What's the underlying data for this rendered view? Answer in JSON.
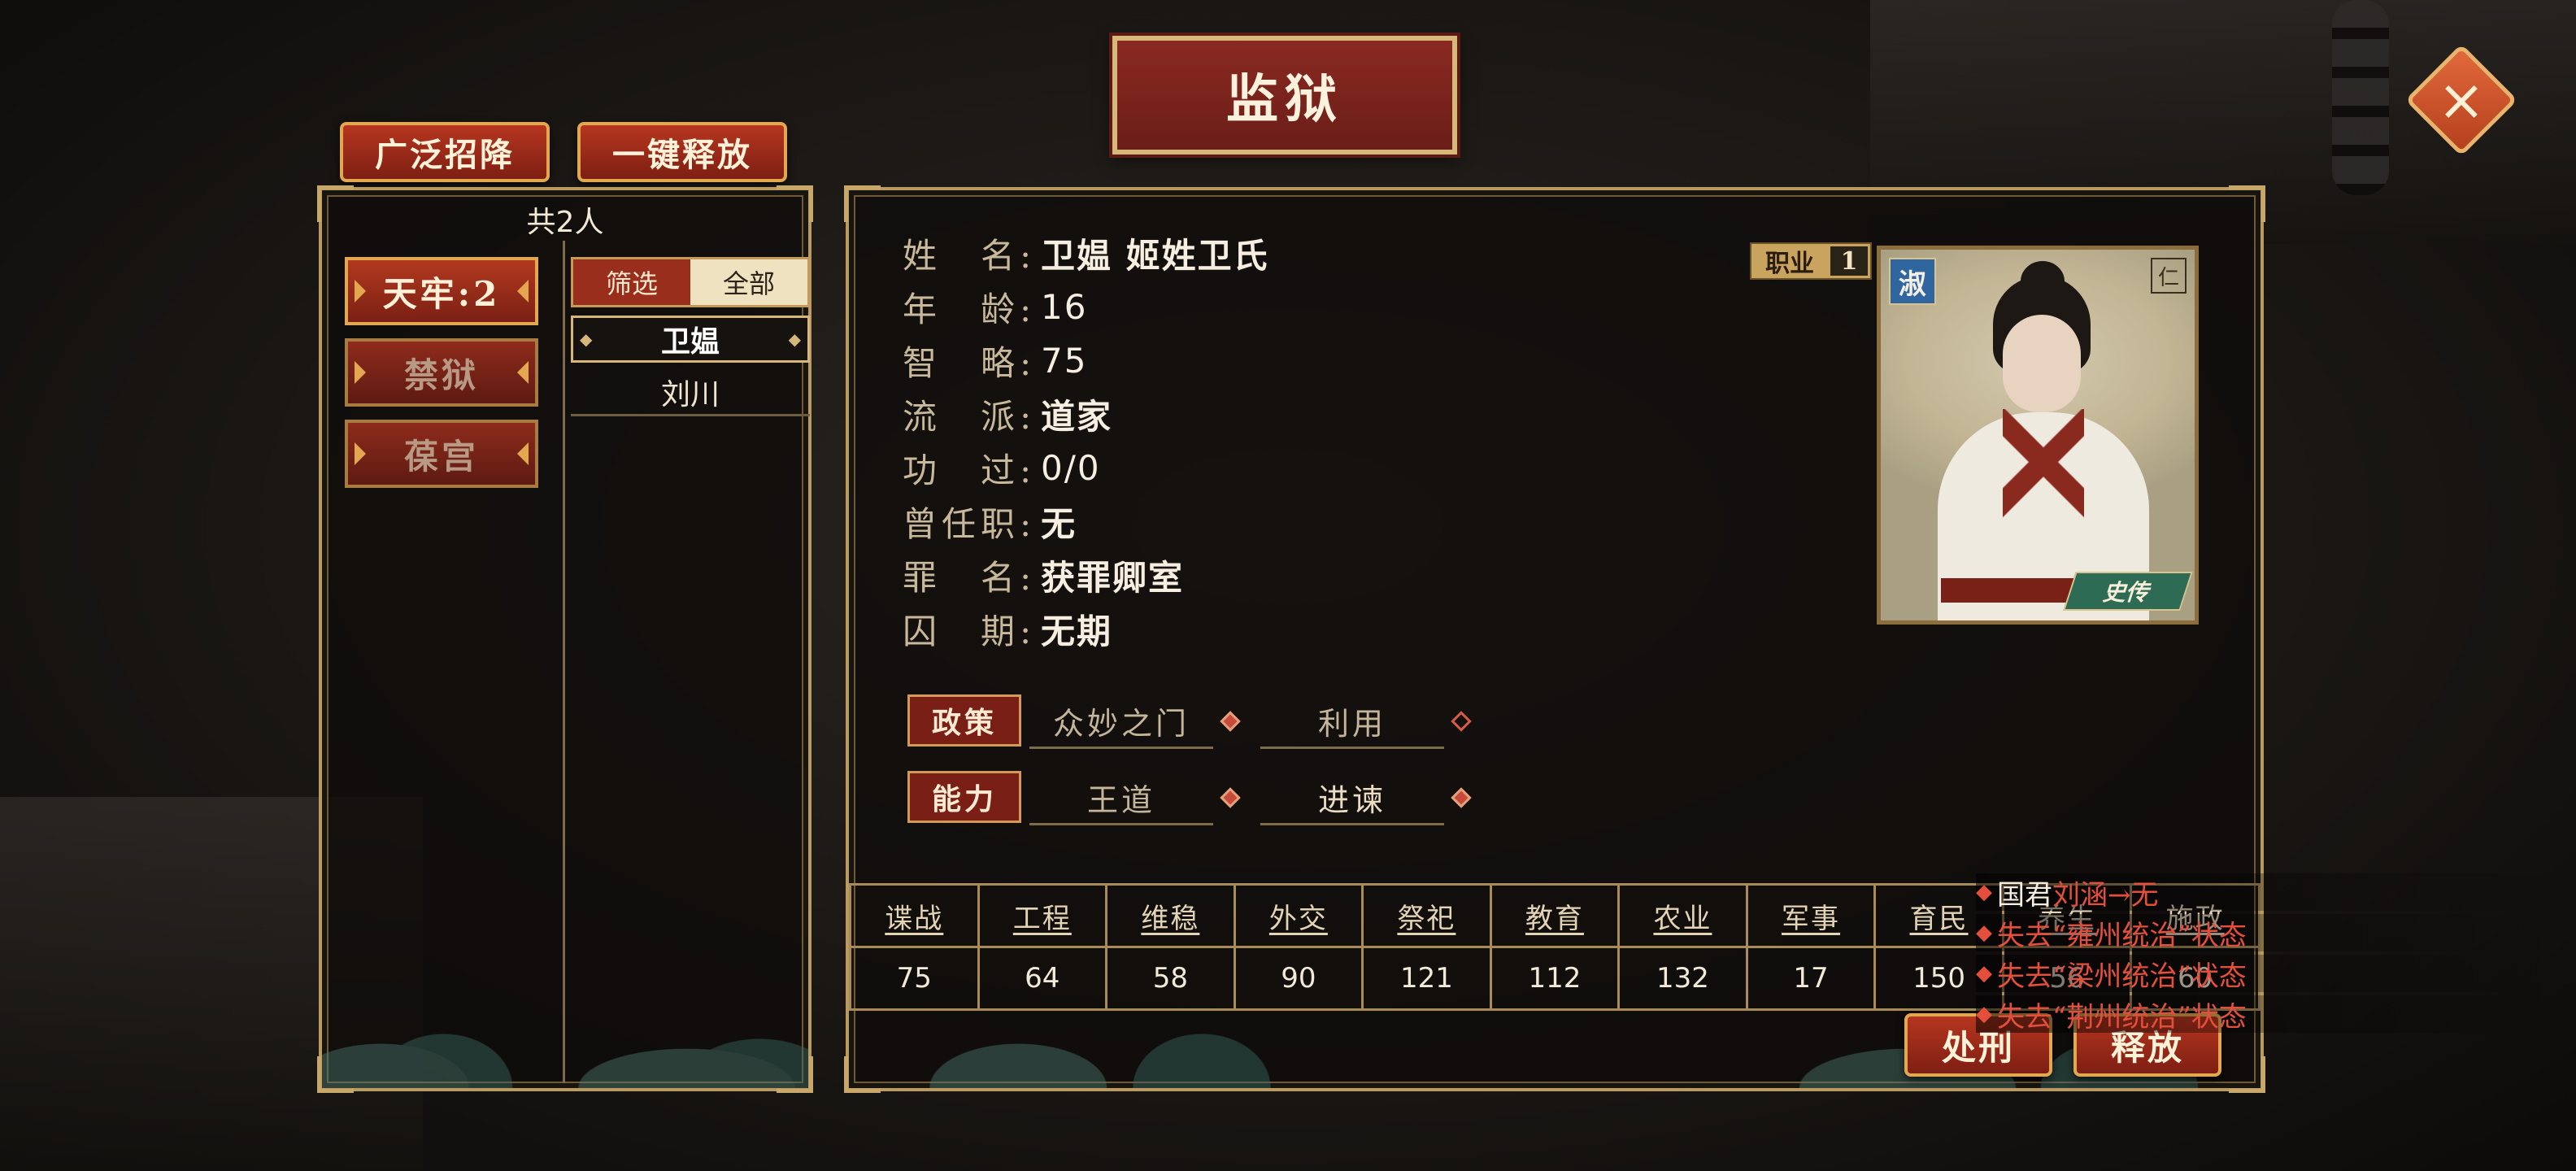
{
  "title": "监狱",
  "top_buttons": {
    "recruit_all": "广泛招降",
    "release_all": "一键释放"
  },
  "prison_panel": {
    "total": "共2人",
    "categories": [
      {
        "label": "天牢:2",
        "active": true
      },
      {
        "label": "禁狱",
        "active": false
      },
      {
        "label": "葆宫",
        "active": false
      }
    ],
    "filter": {
      "label": "筛选",
      "value": "全部"
    },
    "prisoners": [
      "卫媪",
      "刘川"
    ]
  },
  "info": {
    "labels": {
      "name": "姓　名:",
      "age": "年　龄:",
      "strategy": "智　略:",
      "school": "流　派:",
      "merit": "功　过:",
      "former_post": "曾任职:",
      "crime": "罪　名:",
      "sentence": "囚　期:"
    },
    "values": {
      "name": "卫媪  姬姓卫氏",
      "age": "16",
      "strategy": "75",
      "school": "道家",
      "merit": "0/0",
      "former_post": "无",
      "crime": "获罪卿室",
      "sentence": "无期"
    },
    "job_label": "职业",
    "job_level": "1"
  },
  "portrait": {
    "trait_badge": "淑",
    "corner_badge": "仁",
    "bio_label": "史传"
  },
  "policy": {
    "label": "政策",
    "items": [
      "众妙之门",
      "利用"
    ]
  },
  "ability": {
    "label": "能力",
    "items": [
      "王道",
      "进谏"
    ]
  },
  "stats": {
    "headers": [
      "谍战",
      "工程",
      "维稳",
      "外交",
      "祭祀",
      "教育",
      "农业",
      "军事",
      "育民",
      "养生",
      "施政"
    ],
    "values": [
      "75",
      "64",
      "58",
      "90",
      "121",
      "112",
      "132",
      "17",
      "150",
      "56",
      "60"
    ]
  },
  "actions": {
    "execute": "处刑",
    "release": "释放"
  },
  "notifications": [
    {
      "prefix": "国君",
      "text": "刘涵→无"
    },
    {
      "prefix": "",
      "text": "失去“雍州统治”状态"
    },
    {
      "prefix": "",
      "text": "失去“梁州统治”状态"
    },
    {
      "prefix": "",
      "text": "失去“荆州统治”状态"
    }
  ],
  "colors": {
    "accent_red": "#8a2a22",
    "gold": "#d8b77a",
    "alert_red": "#e44f3c"
  }
}
